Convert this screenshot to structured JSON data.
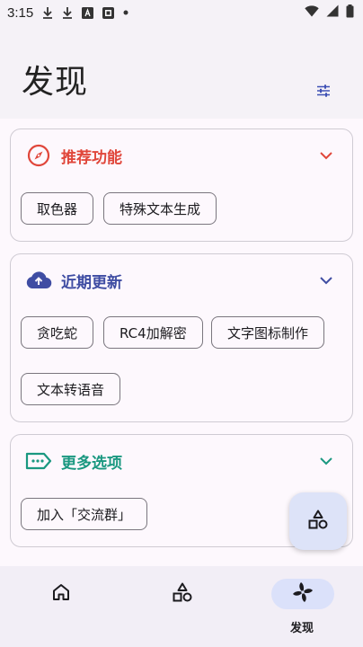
{
  "status_bar": {
    "time": "3:15",
    "icons": [
      "download-icon",
      "download-icon",
      "app-icon",
      "notification-icon",
      "dot-icon",
      "wifi-icon",
      "signal-icon",
      "battery-icon"
    ]
  },
  "header": {
    "title": "发现",
    "action_icon": "tune-icon"
  },
  "sections": [
    {
      "title": "推荐功能",
      "icon": "compass-icon",
      "color": "#e0463a",
      "expanded": true,
      "chips": [
        "取色器",
        "特殊文本生成"
      ]
    },
    {
      "title": "近期更新",
      "icon": "cloud-upload-icon",
      "color": "#3f4da3",
      "expanded": true,
      "chips": [
        "贪吃蛇",
        "RC4加解密",
        "文字图标制作",
        "文本转语音"
      ]
    },
    {
      "title": "更多选项",
      "icon": "label-icon",
      "color": "#1a9880",
      "expanded": true,
      "chips": [
        "加入「交流群」"
      ]
    }
  ],
  "fab": {
    "icon": "shapes-icon"
  },
  "bottom_nav": {
    "items": [
      {
        "icon": "home-icon",
        "label": "",
        "active": false
      },
      {
        "icon": "shapes-icon",
        "label": "",
        "active": false
      },
      {
        "icon": "pinwheel-icon",
        "label": "发现",
        "active": true
      }
    ]
  },
  "colors": {
    "accent": "#3f4da3",
    "red": "#e0463a",
    "teal": "#1a9880",
    "nav_active_bg": "#dbe1fa",
    "fab_bg": "#dde3f8"
  }
}
